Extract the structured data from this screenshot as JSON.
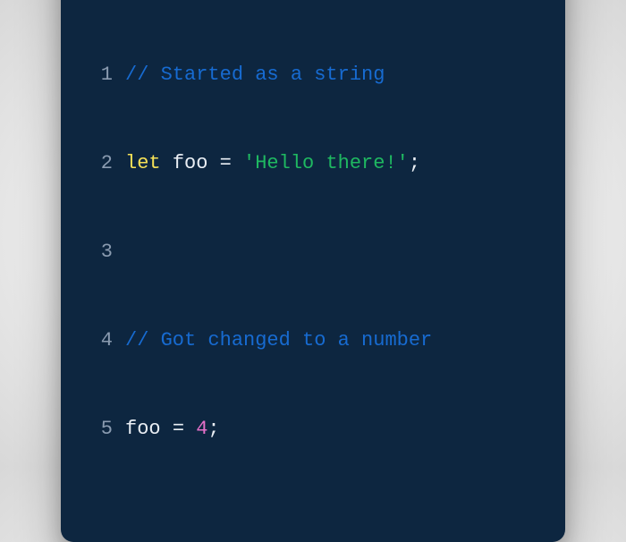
{
  "window": {
    "traffic_colors": {
      "red": "#ed6a5e",
      "yellow": "#f5bf4f",
      "green": "#29ca41"
    }
  },
  "code": {
    "lines": [
      {
        "n": "1",
        "tokens": {
          "t0": "// Started as a string"
        }
      },
      {
        "n": "2",
        "tokens": {
          "t0": "let",
          "t1": " ",
          "t2": "foo",
          "t3": " ",
          "t4": "=",
          "t5": " ",
          "t6": "'Hello there!'",
          "t7": ";"
        }
      },
      {
        "n": "3",
        "tokens": {}
      },
      {
        "n": "4",
        "tokens": {
          "t0": "// Got changed to a number"
        }
      },
      {
        "n": "5",
        "tokens": {
          "t0": "foo",
          "t1": " ",
          "t2": "=",
          "t3": " ",
          "t4": "4",
          "t5": ";"
        }
      }
    ]
  }
}
